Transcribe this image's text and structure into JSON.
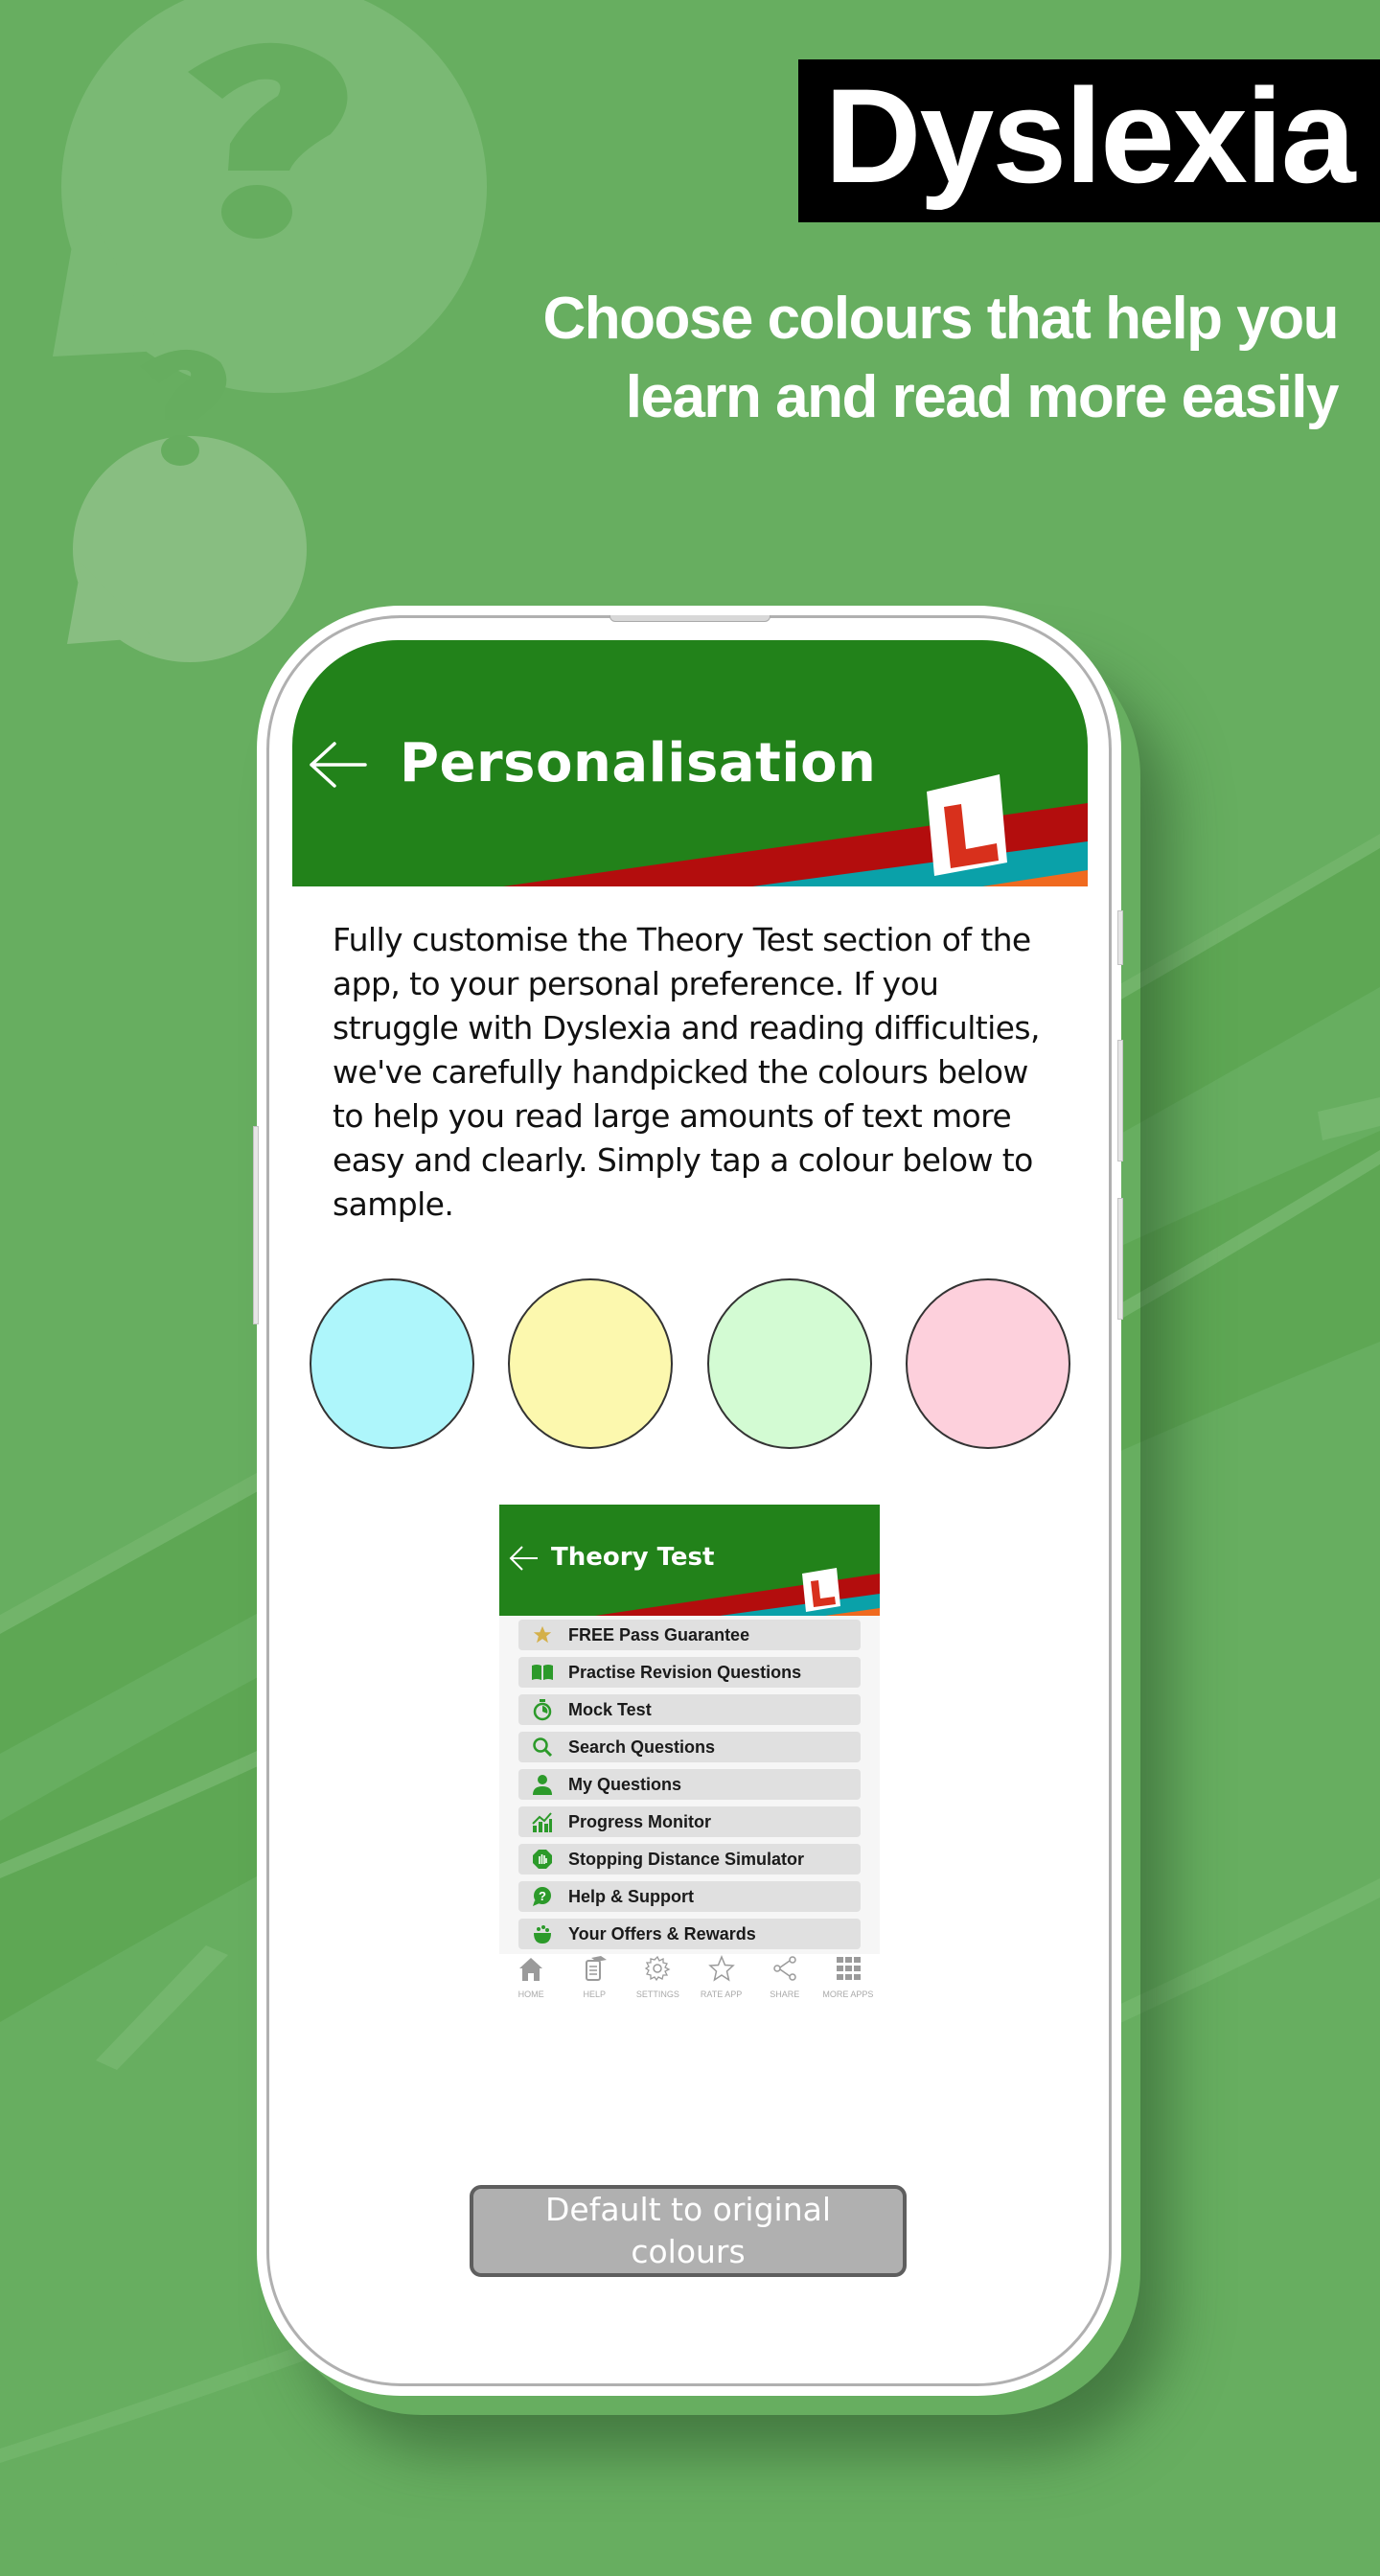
{
  "promo": {
    "title": "Dyslexia",
    "subtitle_line1": "Choose colours that help you",
    "subtitle_line2": "learn and read more easily"
  },
  "colors": {
    "background": "#67ae60",
    "app_green": "#22821a",
    "stripe_red": "#b30d0d",
    "stripe_teal": "#0aa1a9",
    "stripe_orange": "#f06a1f",
    "l_plate_red": "#d8301c"
  },
  "app": {
    "header": {
      "back_icon": "arrow-left-icon",
      "title": "Personalisation",
      "badge_icon": "l-plate-icon"
    },
    "description": "Fully customise the Theory Test section of the app, to your personal preference. If you struggle with Dyslexia and reading difficulties, we've carefully handpicked the colours below to help you read large amounts of text more easy and clearly. Simply tap a colour below to sample.",
    "swatches": [
      {
        "name": "blue",
        "color": "#aef6fb"
      },
      {
        "name": "yellow",
        "color": "#fcf8ae"
      },
      {
        "name": "green",
        "color": "#d3fbd3"
      },
      {
        "name": "pink",
        "color": "#fdd0dc"
      }
    ],
    "preview": {
      "title": "Theory Test",
      "menu": [
        {
          "label": "FREE Pass Guarantee",
          "icon": "star-icon"
        },
        {
          "label": "Practise Revision Questions",
          "icon": "book-icon"
        },
        {
          "label": "Mock Test",
          "icon": "stopwatch-icon"
        },
        {
          "label": "Search Questions",
          "icon": "search-icon"
        },
        {
          "label": "My Questions",
          "icon": "user-icon"
        },
        {
          "label": "Progress Monitor",
          "icon": "chart-icon"
        },
        {
          "label": "Stopping Distance Simulator",
          "icon": "hand-stop-icon"
        },
        {
          "label": "Help & Support",
          "icon": "help-bubble-icon"
        },
        {
          "label": "Your Offers & Rewards",
          "icon": "pot-of-gold-icon"
        }
      ],
      "tabs": [
        {
          "label": "HOME",
          "icon": "home-icon"
        },
        {
          "label": "HELP",
          "icon": "help-doc-icon"
        },
        {
          "label": "SETTINGS",
          "icon": "gear-icon"
        },
        {
          "label": "RATE APP",
          "icon": "star-outline-icon"
        },
        {
          "label": "SHARE",
          "icon": "share-icon"
        },
        {
          "label": "MORE APPS",
          "icon": "grid-icon"
        }
      ]
    },
    "default_button": "Default to original colours"
  }
}
